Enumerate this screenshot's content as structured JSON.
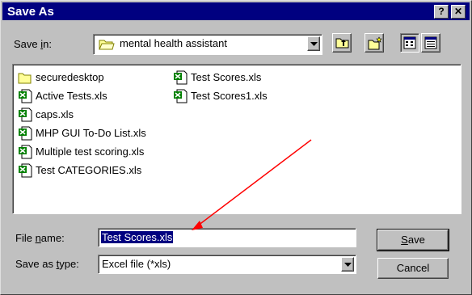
{
  "window": {
    "title": "Save As",
    "help_label": "?",
    "close_label": "✕"
  },
  "save_in": {
    "label_pre": "Save ",
    "label_key": "i",
    "label_post": "n:",
    "value": "mental health assistant"
  },
  "toolbar": {
    "icons": [
      "up-one-level-icon",
      "new-folder-icon",
      "list-view-icon",
      "details-view-icon"
    ]
  },
  "files": [
    {
      "name": "securedesktop",
      "type": "folder"
    },
    {
      "name": "Active Tests.xls",
      "type": "excel"
    },
    {
      "name": "caps.xls",
      "type": "excel"
    },
    {
      "name": "MHP GUI To-Do List.xls",
      "type": "excel"
    },
    {
      "name": "Multiple test scoring.xls",
      "type": "excel"
    },
    {
      "name": "Test CATEGORIES.xls",
      "type": "excel"
    },
    {
      "name": "Test Scores.xls",
      "type": "excel"
    },
    {
      "name": "Test Scores1.xls",
      "type": "excel"
    }
  ],
  "file_name": {
    "label_pre": "File ",
    "label_key": "n",
    "label_post": "ame:",
    "value": "Test Scores.xls"
  },
  "save_as_type": {
    "label_pre": "Save as ",
    "label_key": "t",
    "label_post": "ype:",
    "value": "Excel file (*xls)"
  },
  "buttons": {
    "save_key": "S",
    "save_rest": "ave",
    "cancel": "Cancel"
  },
  "colors": {
    "titlebar": "#000080",
    "selection": "#000080",
    "annotation_arrow": "#ff0000",
    "excel_green": "#008000",
    "folder_yellow": "#ffff99"
  }
}
